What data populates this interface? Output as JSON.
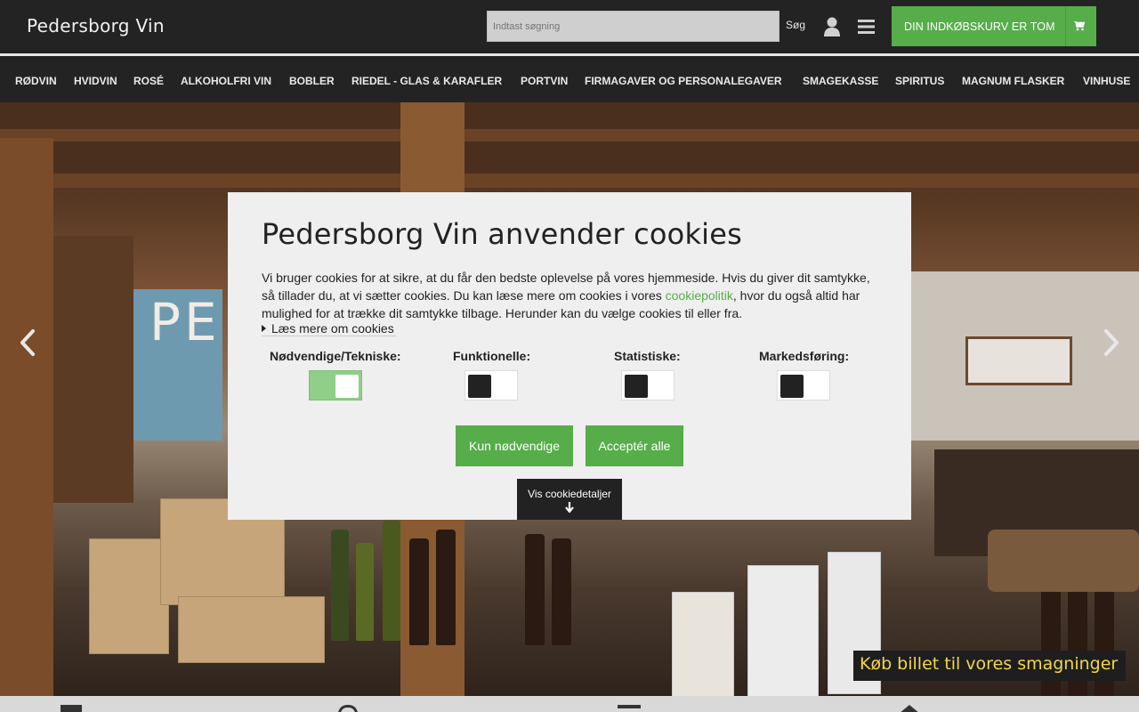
{
  "header": {
    "logo": "Pedersborg Vin",
    "search": {
      "placeholder": "Indtast søgning",
      "button_label": "Søg"
    },
    "cart_label": "DIN INDKØBSKURV ER TOM"
  },
  "nav": {
    "items": [
      {
        "label": "RØDVIN"
      },
      {
        "label": "HVIDVIN"
      },
      {
        "label": "ROSÉ"
      },
      {
        "label": "ALKOHOLFRI VIN"
      },
      {
        "label": "BOBLER"
      },
      {
        "label": "RIEDEL - GLAS & KARAFLER"
      },
      {
        "label": "PORTVIN"
      },
      {
        "label": "FIRMAGAVER OG PERSONALEGAVER"
      },
      {
        "label": "SMAGEKASSE"
      },
      {
        "label": "SPIRITUS"
      },
      {
        "label": "MAGNUM FLASKER"
      },
      {
        "label": "VINHUSE"
      }
    ]
  },
  "hero": {
    "title_partial": "PE",
    "banner_label": "Køb billet til vores smagninger",
    "prev_icon": "chevron-left-icon",
    "next_icon": "chevron-right-icon"
  },
  "cookie": {
    "title": "Pedersborg Vin anvender cookies",
    "text_before_link": "Vi bruger cookies for at sikre, at du får den bedste oplevelse på vores hjemmeside. Hvis du giver dit samtykke, så tillader du, at vi sætter cookies. Du kan læse mere om cookies i vores ",
    "link_label": "cookiepolitik",
    "text_after_link": ", hvor du også altid har mulighed for at trække dit samtykke tilbage. Herunder kan du vælge cookies til eller fra.",
    "read_more": "Læs mere om cookies",
    "categories": [
      {
        "label": "Nødvendige/Tekniske:",
        "enabled": true
      },
      {
        "label": "Funktionelle:",
        "enabled": false
      },
      {
        "label": "Statistiske:",
        "enabled": false
      },
      {
        "label": "Markedsføring:",
        "enabled": false
      }
    ],
    "btn_necessary": "Kun nødvendige",
    "btn_accept_all": "Acceptér alle",
    "details_label": "Vis cookiedetaljer"
  },
  "colors": {
    "accent": "#56ad4a",
    "header_bg": "#232323",
    "banner_text": "#f3d64a"
  }
}
